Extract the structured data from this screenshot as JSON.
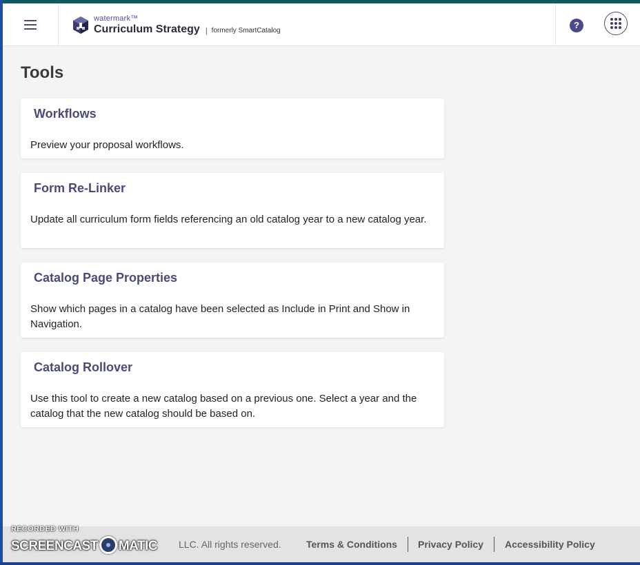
{
  "header": {
    "menu_icon": "hamburger-menu-icon",
    "brand": {
      "logo_icon": "watermark-logo-icon",
      "superscript": "watermark™",
      "product": "Curriculum Strategy",
      "separator": "|",
      "formerly": "formerly SmartCatalog"
    },
    "help_icon": "help-circle-icon",
    "help_glyph": "?",
    "apps_icon": "app-grid-icon"
  },
  "page": {
    "title": "Tools"
  },
  "tools": [
    {
      "title": "Workflows",
      "description": "Preview your proposal workflows."
    },
    {
      "title": "Form Re-Linker",
      "description": "Update all curriculum form fields referencing an old catalog year to a new catalog year."
    },
    {
      "title": "Catalog Page Properties",
      "description": "Show which pages in a catalog have been selected as Include in Print and Show in Navigation."
    },
    {
      "title": "Catalog Rollover",
      "description": "Use this tool to create a new catalog based on a previous one. Select a year and the catalog that the new catalog should be based on."
    }
  ],
  "footer": {
    "copyright": "LLC. All rights reserved.",
    "links": [
      "Terms & Conditions",
      "Privacy Policy",
      "Accessibility Policy"
    ]
  },
  "watermark": {
    "recorded": "RECORDED WITH",
    "part1": "SCREENCAST",
    "part2": "MATIC"
  },
  "colors": {
    "accent": "#4a4a8c",
    "card_title": "#4a4a78",
    "top_strip": "#0e5a63",
    "frame": "#1f4fa0"
  }
}
